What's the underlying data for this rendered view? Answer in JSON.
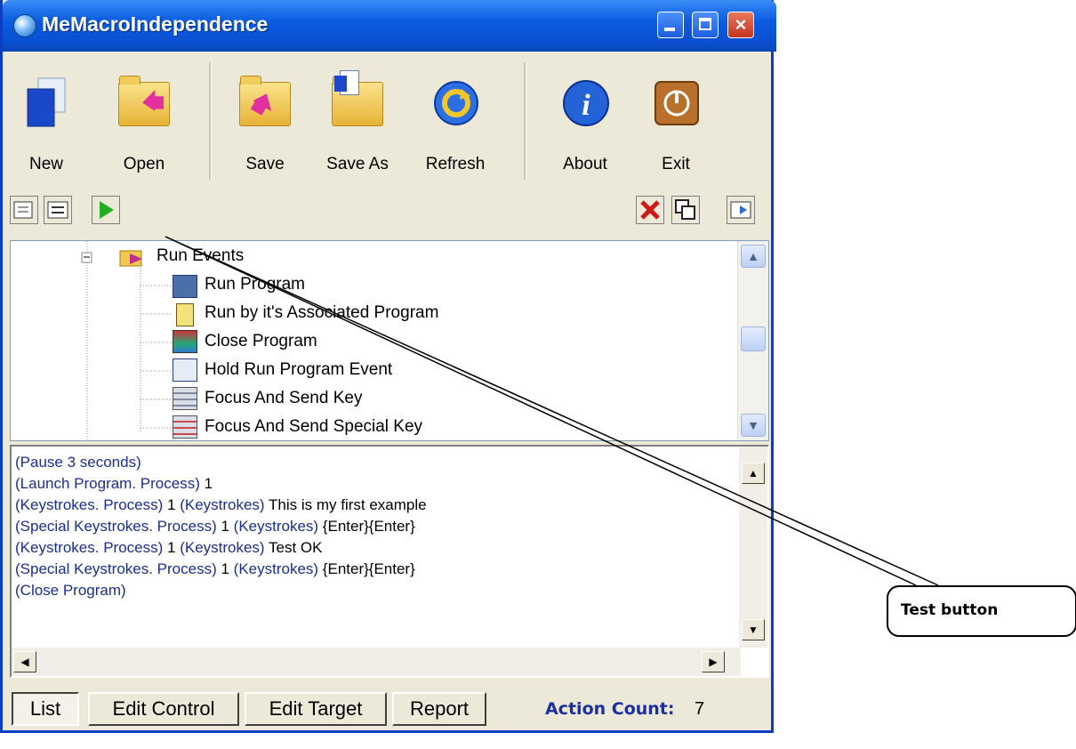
{
  "window": {
    "title": "MeMacroIndependence",
    "minimize": "minimize",
    "maximize": "maximize",
    "close": "×"
  },
  "toolbar": [
    {
      "label": "New",
      "icon": "new-document-icon"
    },
    {
      "label": "Open",
      "icon": "open-folder-icon"
    },
    {
      "label": "Save",
      "icon": "save-folder-icon"
    },
    {
      "label": "Save As",
      "icon": "save-as-folder-icon"
    },
    {
      "label": "Refresh",
      "icon": "refresh-icon"
    },
    {
      "label": "About",
      "icon": "info-icon"
    },
    {
      "label": "Exit",
      "icon": "exit-icon"
    }
  ],
  "tree": {
    "parent": "Run Events",
    "items": [
      "Run Program",
      "Run by it's Associated Program",
      "Close Program",
      "Hold Run Program Event",
      "Focus And Send Key",
      "Focus And Send Special Key"
    ]
  },
  "action_list": [
    {
      "parts": [
        {
          "t": "(Pause 3 seconds)",
          "c": "blue"
        }
      ]
    },
    {
      "parts": [
        {
          "t": "(Launch Program. Process) ",
          "c": "blue"
        },
        {
          "t": "1",
          "c": "black"
        }
      ]
    },
    {
      "parts": [
        {
          "t": "(Keystrokes.  Process) ",
          "c": "blue"
        },
        {
          "t": "1 ",
          "c": "black"
        },
        {
          "t": "(Keystrokes) ",
          "c": "blue"
        },
        {
          "t": "This is my first example",
          "c": "black"
        }
      ]
    },
    {
      "parts": [
        {
          "t": "(Special Keystrokes. Process) ",
          "c": "blue"
        },
        {
          "t": "1 ",
          "c": "black"
        },
        {
          "t": "(Keystrokes) ",
          "c": "blue"
        },
        {
          "t": "{Enter}{Enter}",
          "c": "black"
        }
      ]
    },
    {
      "parts": [
        {
          "t": "(Keystrokes.  Process) ",
          "c": "blue"
        },
        {
          "t": "1 ",
          "c": "black"
        },
        {
          "t": "(Keystrokes) ",
          "c": "blue"
        },
        {
          "t": "Test OK",
          "c": "black"
        }
      ]
    },
    {
      "parts": [
        {
          "t": "(Special Keystrokes. Process) ",
          "c": "blue"
        },
        {
          "t": "1 ",
          "c": "black"
        },
        {
          "t": "(Keystrokes) ",
          "c": "blue"
        },
        {
          "t": "{Enter}{Enter}",
          "c": "black"
        }
      ]
    },
    {
      "parts": [
        {
          "t": "(Close Program)",
          "c": "blue"
        }
      ]
    }
  ],
  "tabs": [
    {
      "label": "List",
      "selected": true
    },
    {
      "label": "Edit Control",
      "selected": false
    },
    {
      "label": "Edit Target",
      "selected": false
    },
    {
      "label": "Report",
      "selected": false
    }
  ],
  "action_count": {
    "label": "Action Count:",
    "value": "7"
  },
  "annotation": {
    "label": "Test button"
  },
  "colors": {
    "title_bar": "#0b5ce0",
    "list_text": "#1a2f8c",
    "play": "#22b022"
  }
}
